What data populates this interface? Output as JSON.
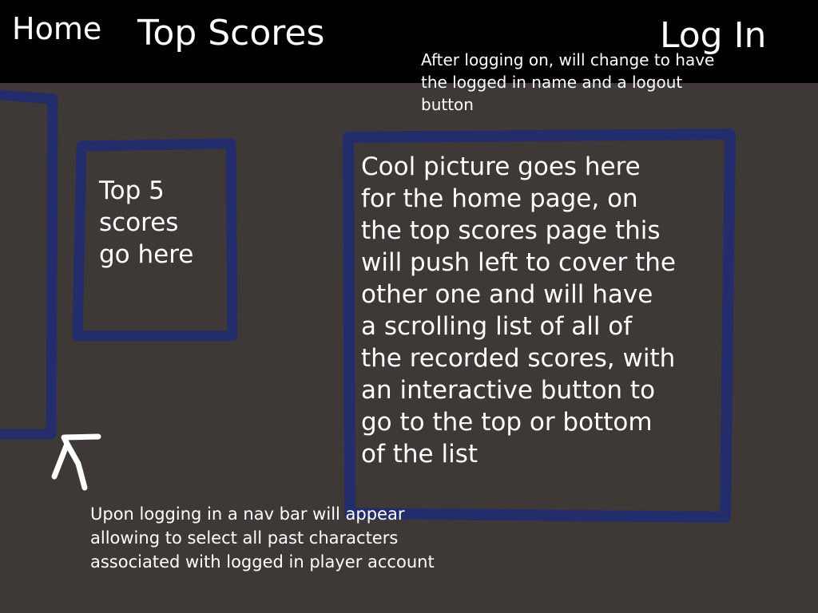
{
  "nav": {
    "home_label": "Home",
    "top_scores_label": "Top Scores",
    "login_label": "Log In"
  },
  "notes": {
    "login_note": "After logging on, will change to have\nthe logged in name and a logout\nbutton",
    "nav_bar_note": "Upon logging in a nav bar will appear\nallowing to select all past characters\nassociated with logged in player account"
  },
  "panels": {
    "top5_text": "Top 5\nscores\ngo here",
    "picture_text": "Cool picture goes here\nfor the home page, on\nthe top scores page this\nwill push left to cover the\nother one and will have\na scrolling list of all of\nthe recorded scores, with\nan interactive button to\ngo to the top or bottom\nof the list"
  },
  "colors": {
    "background": "#3e3837",
    "topbar": "#000000",
    "outline": "#232d6b",
    "text": "#ffffff"
  }
}
